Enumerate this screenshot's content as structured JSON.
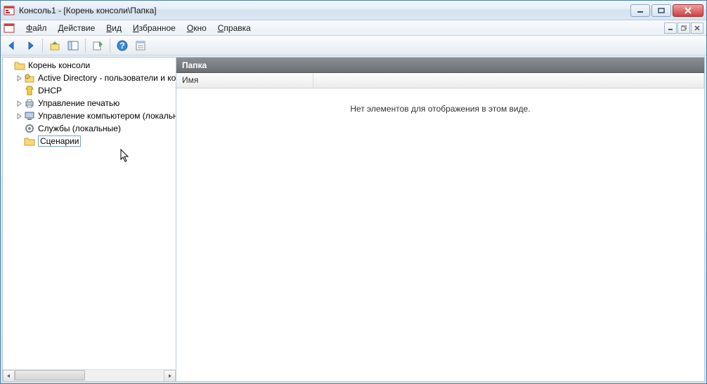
{
  "title": "Консоль1 - [Корень консоли\\Папка]",
  "menu": {
    "file": {
      "text": "Файл",
      "ul": "Ф"
    },
    "action": {
      "text": "Действие",
      "ul": "Д"
    },
    "view": {
      "text": "Вид",
      "ul": "В"
    },
    "fav": {
      "text": "Избранное",
      "ul": "И"
    },
    "window": {
      "text": "Окно",
      "ul": "О"
    },
    "help": {
      "text": "Справка",
      "ul": "С"
    }
  },
  "tree": {
    "root": "Корень консоли",
    "items": [
      {
        "label": "Active Directory - пользователи и компьютеры",
        "expandable": true,
        "icon": "ad"
      },
      {
        "label": "DHCP",
        "expandable": false,
        "icon": "dhcp"
      },
      {
        "label": "Управление печатью",
        "expandable": true,
        "icon": "print"
      },
      {
        "label": "Управление компьютером (локальным)",
        "expandable": true,
        "icon": "computer"
      },
      {
        "label": "Службы (локальные)",
        "expandable": false,
        "icon": "services"
      }
    ],
    "editing": "Сценарии"
  },
  "detail": {
    "header": "Папка",
    "column": "Имя",
    "empty": "Нет элементов для отображения в этом виде."
  }
}
